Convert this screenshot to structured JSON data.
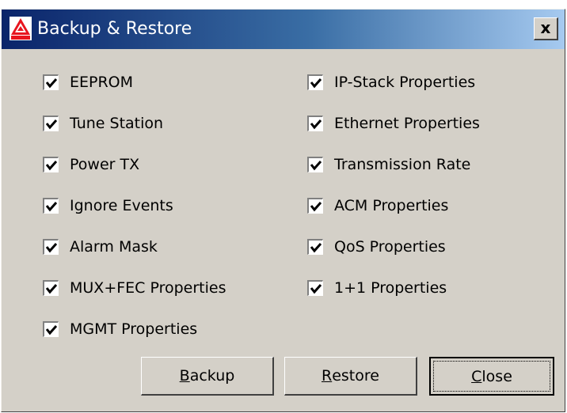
{
  "dialog": {
    "title": "Backup & Restore",
    "close_glyph": "x",
    "logo_icon": "red-triangle-logo-icon",
    "close_icon": "close-icon"
  },
  "checkboxes": {
    "left": [
      {
        "label": "EEPROM",
        "checked": true
      },
      {
        "label": "Tune Station",
        "checked": true
      },
      {
        "label": "Power TX",
        "checked": true
      },
      {
        "label": "Ignore Events",
        "checked": true
      },
      {
        "label": "Alarm Mask",
        "checked": true
      },
      {
        "label": "MUX+FEC Properties",
        "checked": true
      },
      {
        "label": "MGMT Properties",
        "checked": true
      }
    ],
    "right": [
      {
        "label": "IP-Stack Properties",
        "checked": true
      },
      {
        "label": "Ethernet Properties",
        "checked": true
      },
      {
        "label": "Transmission Rate",
        "checked": true
      },
      {
        "label": "ACM Properties",
        "checked": true
      },
      {
        "label": "QoS Properties",
        "checked": true
      },
      {
        "label": "1+1 Properties",
        "checked": true
      }
    ]
  },
  "buttons": {
    "backup": {
      "mnemonic": "B",
      "rest": "ackup"
    },
    "restore": {
      "mnemonic": "R",
      "rest": "estore"
    },
    "close": {
      "mnemonic": "C",
      "rest": "lose"
    }
  },
  "colors": {
    "dialog_bg": "#d4d0c8",
    "title_gradient_start": "#0a246a",
    "title_gradient_end": "#a6caf0",
    "logo_red": "#e8141e"
  }
}
